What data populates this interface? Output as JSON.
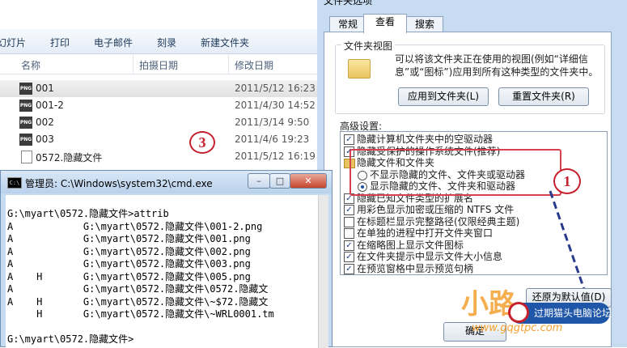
{
  "explorer": {
    "toolbar": [
      "幻灯片",
      "打印",
      "电子邮件",
      "刻录",
      "新建文件夹"
    ],
    "columns": {
      "name": "名称",
      "date_taken": "拍摄日期",
      "date_modified": "修改日期"
    },
    "files": [
      {
        "name": "001",
        "date": "2011/5/12 16:23",
        "icon": "png-file-icon",
        "icon_label": "PNG",
        "selected": true
      },
      {
        "name": "001-2",
        "date": "2011/4/30 14:52",
        "icon": "png-file-icon",
        "icon_label": "PNG",
        "selected": false
      },
      {
        "name": "002",
        "date": "2011/3/14 9:50",
        "icon": "png-file-icon",
        "icon_label": "PNG",
        "selected": false
      },
      {
        "name": "003",
        "date": "2011/4/6 19:23",
        "icon": "png-file-icon",
        "icon_label": "PNG",
        "selected": false
      },
      {
        "name": "0572.隐藏文件",
        "date": "2011/5/12 16:19",
        "icon": "document-icon",
        "icon_label": "",
        "selected": false
      }
    ]
  },
  "annotations": {
    "badge_1": "1",
    "badge_3": "3"
  },
  "cmd": {
    "title": "管理员: C:\\Windows\\system32\\cmd.exe",
    "icon_label": "C:\\",
    "lines": [
      "G:\\myart\\0572.隐藏文件>attrib",
      "A            G:\\myart\\0572.隐藏文件\\001-2.png",
      "A            G:\\myart\\0572.隐藏文件\\001.png",
      "A            G:\\myart\\0572.隐藏文件\\002.png",
      "A            G:\\myart\\0572.隐藏文件\\003.png",
      "A    H       G:\\myart\\0572.隐藏文件\\005.png",
      "A            G:\\myart\\0572.隐藏文件\\0572.隐藏文",
      "A    H       G:\\myart\\0572.隐藏文件\\~$72.隐藏文",
      "     H       G:\\myart\\0572.隐藏文件\\~WRL0001.tm",
      "",
      "G:\\myart\\0572.隐藏文件>"
    ]
  },
  "dialog": {
    "title": "文件夹选项",
    "tabs": [
      {
        "label": "常规",
        "active": false
      },
      {
        "label": "查看",
        "active": true
      },
      {
        "label": "搜索",
        "active": false
      }
    ],
    "folder_views": {
      "label": "文件夹视图",
      "text_lines": [
        "可以将该文件夹正在使用的视图(例如“详细信",
        "息”或“图标”)应用到所有这种类型的文件夹中。"
      ],
      "apply_button": "应用到文件夹(L)",
      "reset_button": "重置文件夹(R)"
    },
    "advanced_label": "高级设置:",
    "advanced_items": [
      {
        "type": "checkbox",
        "checked": true,
        "label": "隐藏计算机文件夹中的空驱动器"
      },
      {
        "type": "checkbox",
        "checked": true,
        "label": "隐藏受保护的操作系统文件(推荐)"
      },
      {
        "type": "folder",
        "label": "隐藏文件和文件夹"
      },
      {
        "type": "radio",
        "checked": false,
        "label": "不显示隐藏的文件、文件夹或驱动器"
      },
      {
        "type": "radio",
        "checked": true,
        "label": "显示隐藏的文件、文件夹和驱动器"
      },
      {
        "type": "checkbox",
        "checked": true,
        "label": "隐藏已知文件类型的扩展名"
      },
      {
        "type": "checkbox",
        "checked": true,
        "label": "用彩色显示加密或压缩的 NTFS 文件"
      },
      {
        "type": "checkbox",
        "checked": false,
        "label": "在标题栏显示完整路径(仅限经典主题)"
      },
      {
        "type": "checkbox",
        "checked": false,
        "label": "在单独的进程中打开文件夹窗口"
      },
      {
        "type": "checkbox",
        "checked": true,
        "label": "在缩略图上显示文件图标"
      },
      {
        "type": "checkbox",
        "checked": true,
        "label": "在文件夹提示中显示文件大小信息"
      },
      {
        "type": "checkbox",
        "checked": true,
        "label": "在预览窗格中显示预览句柄"
      }
    ],
    "restore_button": "还原为默认值(D)",
    "ok_button": "确定"
  },
  "watermark": {
    "text": "小路",
    "url": "www.gqgtpc.com",
    "badge": "过期猫头电脑论坛"
  },
  "colors": {
    "accent": "#c61f2d",
    "dialog_bg": "#c7dbf1",
    "cmd_frame": "#c6dcf2"
  }
}
